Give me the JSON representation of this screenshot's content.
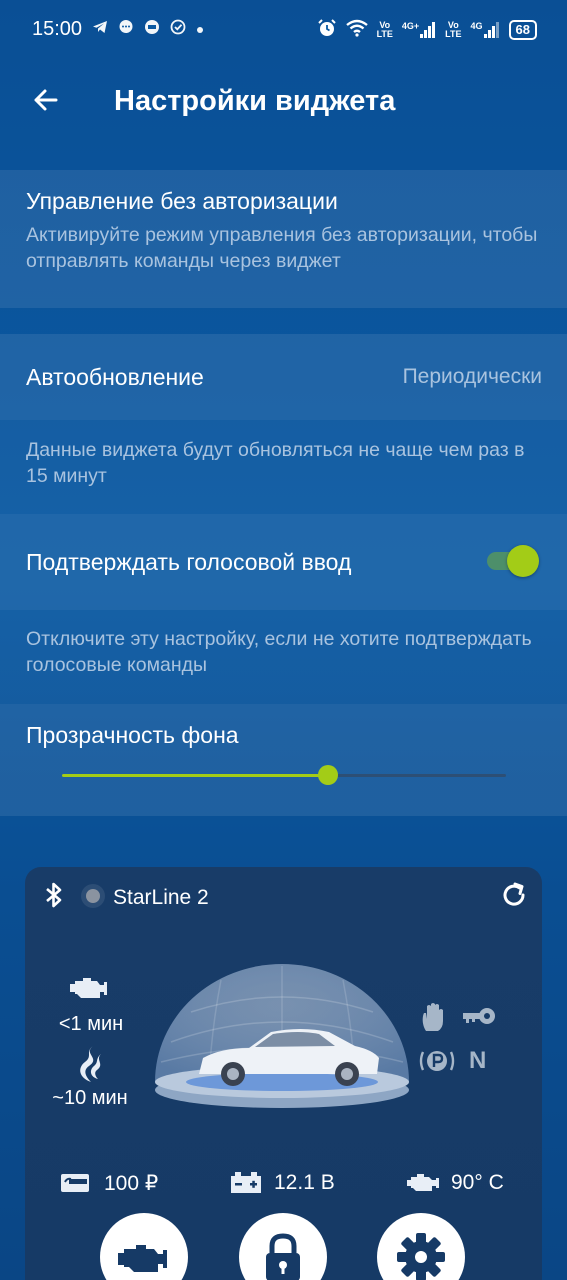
{
  "status_bar": {
    "time": "15:00",
    "notification_icons": [
      "telegram-icon",
      "chat-bubble-icon",
      "mail-badge-icon",
      "check-circle-icon",
      "dot-icon"
    ],
    "network1_top": "Vo",
    "network1_bottom": "LTE",
    "network1_gen": "4G+",
    "network2_top": "Vo",
    "network2_bottom": "LTE",
    "network2_gen": "4G",
    "battery": "68"
  },
  "app_bar": {
    "title": "Настройки виджета"
  },
  "settings": {
    "no_auth": {
      "title": "Управление без авторизации",
      "subtitle": "Активируйте режим управления без авторизации, чтобы отправлять команды через виджет"
    },
    "autoupdate": {
      "title": "Автообновление",
      "value": "Периодически",
      "hint": "Данные виджета будут обновляться не чаще чем раз в 15 минут"
    },
    "voice_confirm": {
      "title": "Подтверждать голосовой ввод",
      "enabled": true,
      "hint": "Отключите эту настройку, если не хотите подтверждать голосовые команды"
    },
    "transparency": {
      "title": "Прозрачность фона",
      "value_fraction": 0.6
    }
  },
  "widget": {
    "device_name": "StarLine 2",
    "engine_time": "<1 мин",
    "heater_time": "~10 мин",
    "balance": "100 ₽",
    "voltage": "12.1 В",
    "engine_temp": "90° С",
    "gear": "N",
    "colors": {
      "accent": "#a3cc17",
      "card": "#163a66",
      "muted_text": "#a9c3df"
    }
  }
}
